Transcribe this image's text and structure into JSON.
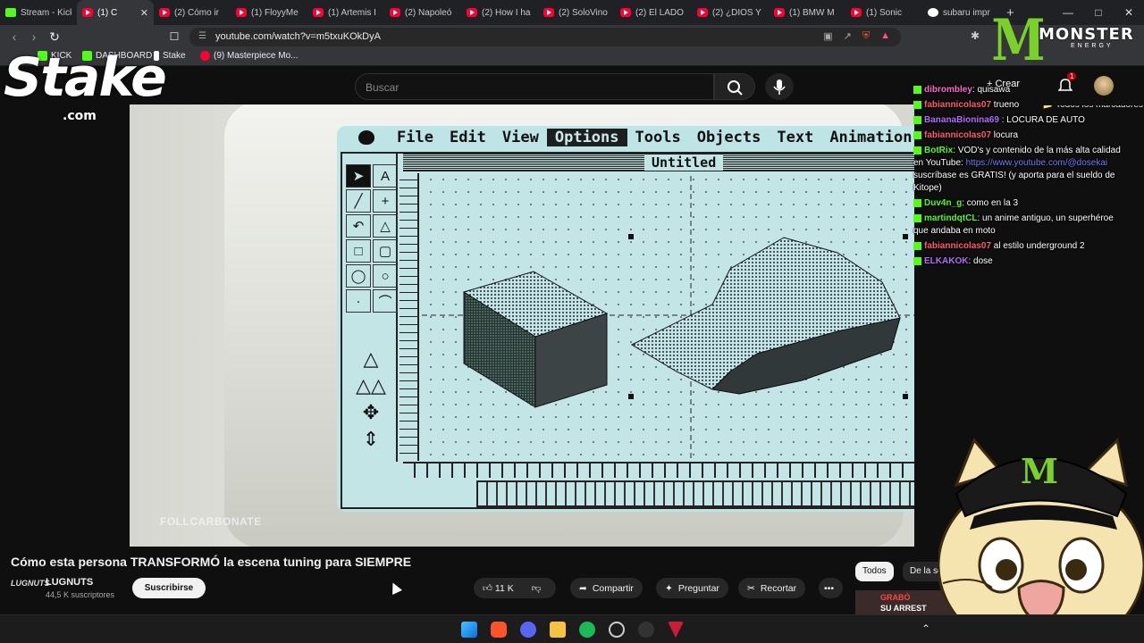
{
  "browser": {
    "tabs": [
      {
        "title": "Stream - Kick",
        "icon": "kick"
      },
      {
        "title": "(1) C",
        "icon": "youtube",
        "active": true
      },
      {
        "title": "(2) Cómo ir",
        "icon": "youtube"
      },
      {
        "title": "(1) FloyyMe",
        "icon": "youtube"
      },
      {
        "title": "(1) Artemis I",
        "icon": "youtube"
      },
      {
        "title": "(2) Napoleó",
        "icon": "youtube"
      },
      {
        "title": "(2) How I ha",
        "icon": "youtube"
      },
      {
        "title": "(2) SoloVino",
        "icon": "youtube"
      },
      {
        "title": "(2) El LADO",
        "icon": "youtube"
      },
      {
        "title": "(2) ¿DIOS Y",
        "icon": "youtube"
      },
      {
        "title": "(1) BMW M",
        "icon": "youtube"
      },
      {
        "title": "(1) Sonic",
        "icon": "youtube"
      },
      {
        "title": "subaru impr",
        "icon": "google"
      }
    ],
    "new_tab": "+",
    "url": "youtube.com/watch?v=m5txuKOkDyA",
    "bookmarks": [
      {
        "label": "KICK",
        "color": "#53fc18"
      },
      {
        "label": "DASHBOARD",
        "color": "#53fc18"
      },
      {
        "label": "Stake",
        "color": "#ffffff"
      },
      {
        "label": "(9) Masterpiece Mo...",
        "color": "#ff0033"
      }
    ],
    "all_bookmarks": "Todos los marcadores"
  },
  "youtube": {
    "search_placeholder": "Buscar",
    "create_label": "Crear",
    "notifications_count": "1",
    "video_title": "Cómo esta persona TRANSFORMÓ la escena tuning para SIEMPRE",
    "channel_logo": "LUGNUTS",
    "channel_name": "LUGNUTS",
    "subscribers": "44,5 K suscriptores",
    "subscribe_label": "Suscribirse",
    "likes": "11 K",
    "share_label": "Compartir",
    "ask_label": "Preguntar",
    "clip_label": "Recortar",
    "more_label": "•••",
    "filter_chips": [
      "Todos",
      "De la seri"
    ],
    "suggested_thumb": {
      "line1": "GRABÓ",
      "line2": "SU ARREST"
    }
  },
  "video": {
    "mac_menu": [
      "File",
      "Edit",
      "View",
      "Options",
      "Tools",
      "Objects",
      "Text",
      "Animation"
    ],
    "selected_menu": "Options",
    "window_title": "Untitled",
    "watermark": "FOLLCARBONATE"
  },
  "overlay": {
    "stake_word": "Stake",
    "stake_com": ".com",
    "monster_word": "MONSTER",
    "monster_energy": "ENERGY",
    "chat": [
      {
        "user": "dibrombley",
        "user_color": "#ff66cc",
        "text": ": quisawa"
      },
      {
        "user": "fabiannicolas07",
        "user_color": "#ff5a6e",
        "text": " trueno"
      },
      {
        "user": "BananaBionina69",
        "user_color": "#b36bff",
        "text": " : LOCURA DE AUTO"
      },
      {
        "user": "fabiannicolas07",
        "user_color": "#ff5a6e",
        "text": " locura"
      },
      {
        "user": "BotRix",
        "user_color": "#53fc18",
        "text": ": VOD's y contenido de la más alta calidad en YouTube: ",
        "link": "https://www.youtube.com/@dosekai",
        "after": " suscríbase es GRATIS! (y aporta para el sueldo de Kitope)"
      },
      {
        "user": "Duv4n_g",
        "user_color": "#53fc18",
        "text": ": como en la 3"
      },
      {
        "user": "martindqtCL",
        "user_color": "#53fc18",
        "text": ": un anime antiguo, un superhéroe que andaba en moto"
      },
      {
        "user": "fabiannicolas07",
        "user_color": "#ff5a6e",
        "text": " al estilo underground 2"
      },
      {
        "user": "ELKAKOK",
        "user_color": "#b36bff",
        "text": ": dose"
      }
    ]
  },
  "colors": {
    "youtube_red": "#ff0033",
    "kick_green": "#53fc18",
    "screen_cyan": "#bfe4e6"
  }
}
